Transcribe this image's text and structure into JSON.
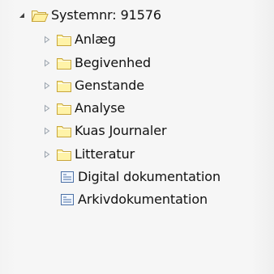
{
  "tree": {
    "root": {
      "label": "Systemnr: 91576",
      "expanded": true,
      "icon": "folder-open-icon",
      "children": [
        {
          "label": "Anlæg",
          "icon": "folder-icon",
          "expandable": true
        },
        {
          "label": "Begivenhed",
          "icon": "folder-icon",
          "expandable": true
        },
        {
          "label": "Genstande",
          "icon": "folder-icon",
          "expandable": true
        },
        {
          "label": "Analyse",
          "icon": "folder-icon",
          "expandable": true
        },
        {
          "label": "Kuas Journaler",
          "icon": "folder-icon",
          "expandable": true
        },
        {
          "label": "Litteratur",
          "icon": "folder-icon",
          "expandable": true
        },
        {
          "label": "Digital dokumentation",
          "icon": "document-list-icon",
          "expandable": false
        },
        {
          "label": "Arkivdokumentation",
          "icon": "document-list-icon",
          "expandable": false
        }
      ]
    }
  },
  "colors": {
    "folder_fill": "#fff3a8",
    "folder_stroke": "#c8a53a",
    "document_stroke": "#4a6fa5",
    "arrow_expanded": "#404040",
    "arrow_collapsed": "#9aa3ad"
  }
}
